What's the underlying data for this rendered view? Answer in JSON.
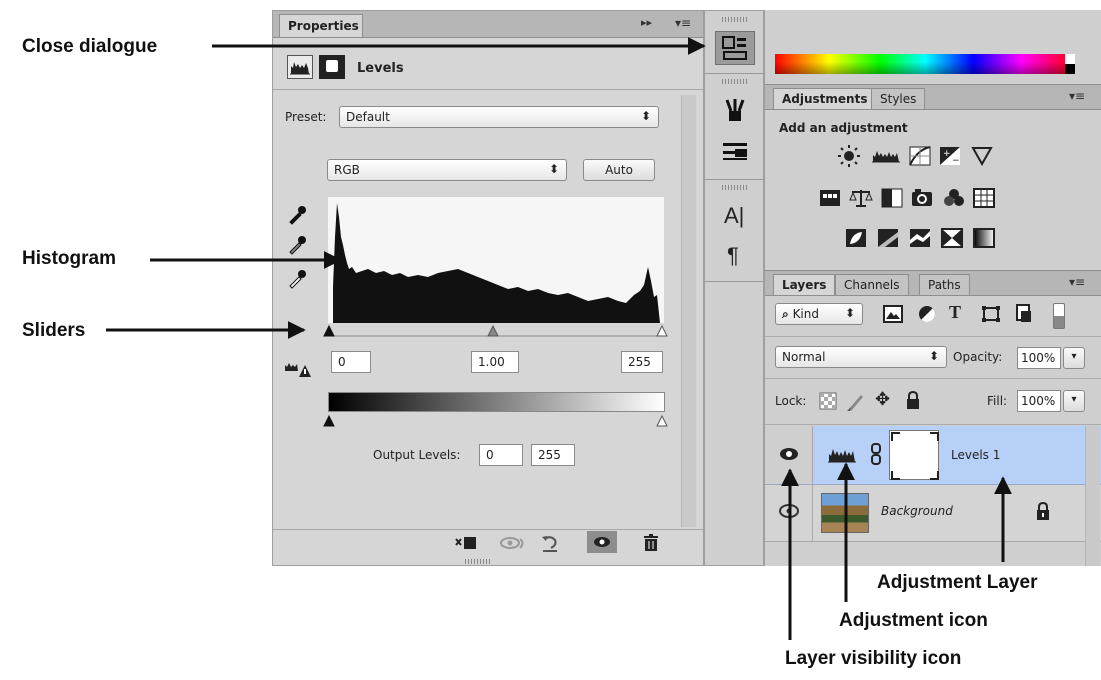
{
  "annotations": {
    "close_dialogue": "Close dialogue",
    "histogram": "Histogram",
    "sliders": "Sliders",
    "adjustment_layer": "Adjustment Layer",
    "adjustment_icon": "Adjustment icon",
    "layer_visibility_icon": "Layer visibility icon"
  },
  "properties_panel": {
    "tab_label": "Properties",
    "collapse_icon": "▸▸",
    "menu_icon": "▾≡",
    "header_title": "Levels",
    "preset_label": "Preset:",
    "preset_value": "Default",
    "channel_value": "RGB",
    "auto_label": "Auto",
    "input_black": "0",
    "input_gamma": "1.00",
    "input_white": "255",
    "output_label": "Output Levels:",
    "output_black": "0",
    "output_white": "255"
  },
  "adjustments_panel": {
    "tabs": [
      "Adjustments",
      "Styles"
    ],
    "heading": "Add an adjustment"
  },
  "layers_panel": {
    "tabs": [
      "Layers",
      "Channels",
      "Paths"
    ],
    "filter_kind": "Kind",
    "blend_mode": "Normal",
    "opacity_label": "Opacity:",
    "opacity_value": "100%",
    "lock_label": "Lock:",
    "fill_label": "Fill:",
    "fill_value": "100%",
    "layers": [
      {
        "name": "Levels 1",
        "selected": true
      },
      {
        "name": "Background",
        "selected": false
      }
    ]
  },
  "icons": {
    "properties_tool": "properties-icon",
    "brushes_tool": "brush-icon",
    "brush_presets_tool": "brush-presets-icon",
    "character_tool": "character-icon",
    "paragraph_tool": "paragraph-icon"
  },
  "colors": {
    "selected_layer": "#b7d0f7",
    "panel_bg": "#d6d6d6"
  }
}
